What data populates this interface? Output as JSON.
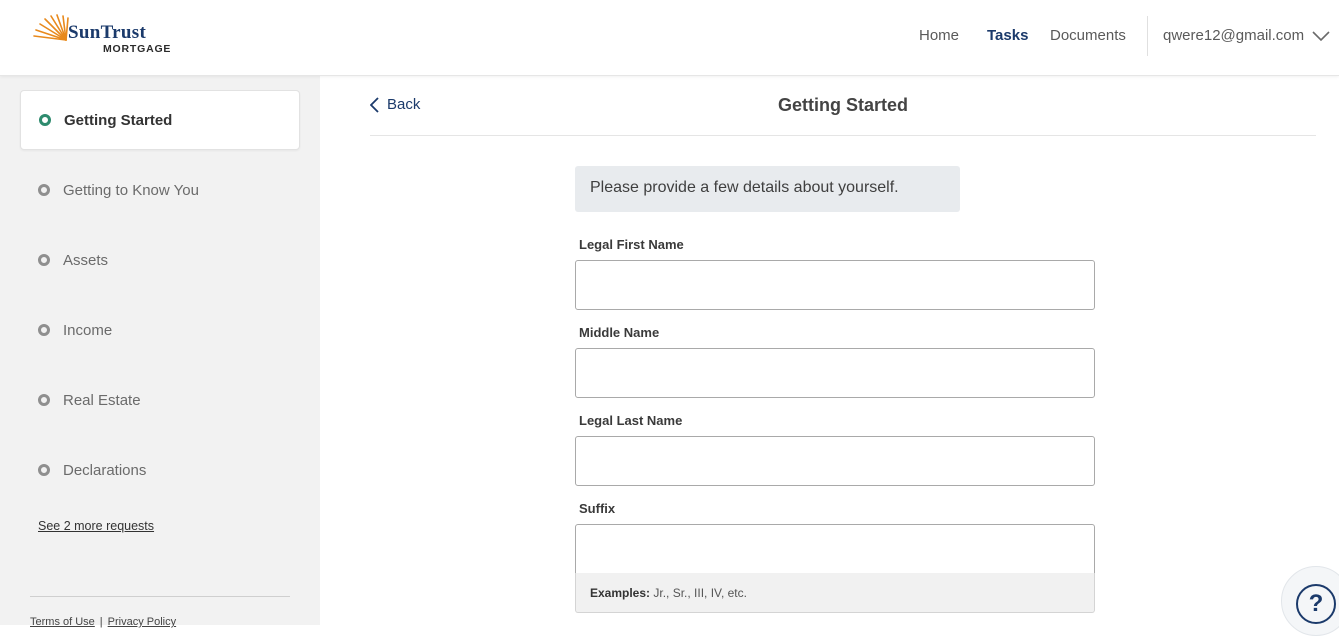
{
  "brand": {
    "name": "SunTrust",
    "sub": "MORTGAGE",
    "colors": {
      "navy": "#1b3a6b",
      "orange": "#e8891c",
      "green": "#2e8b6e"
    }
  },
  "nav": {
    "home": "Home",
    "tasks": "Tasks",
    "documents": "Documents",
    "user_email": "qwere12@gmail.com"
  },
  "sidebar": {
    "steps": [
      {
        "label": "Getting Started",
        "active": true
      },
      {
        "label": "Getting to Know You",
        "active": false
      },
      {
        "label": "Assets",
        "active": false
      },
      {
        "label": "Income",
        "active": false
      },
      {
        "label": "Real Estate",
        "active": false
      },
      {
        "label": "Declarations",
        "active": false
      }
    ],
    "more_link": "See 2 more requests",
    "footer": {
      "terms": "Terms of Use",
      "privacy": "Privacy Policy"
    }
  },
  "main": {
    "back_label": "Back",
    "title": "Getting Started",
    "intro": "Please provide a few details about yourself.",
    "fields": [
      {
        "label": "Legal First Name",
        "value": ""
      },
      {
        "label": "Middle Name",
        "value": ""
      },
      {
        "label": "Legal Last Name",
        "value": ""
      },
      {
        "label": "Suffix",
        "value": ""
      }
    ],
    "suffix_hint_bold": "Examples:",
    "suffix_hint": "Jr., Sr., III, IV, etc."
  },
  "help": {
    "icon": "question-circle-icon",
    "glyph": "?"
  }
}
